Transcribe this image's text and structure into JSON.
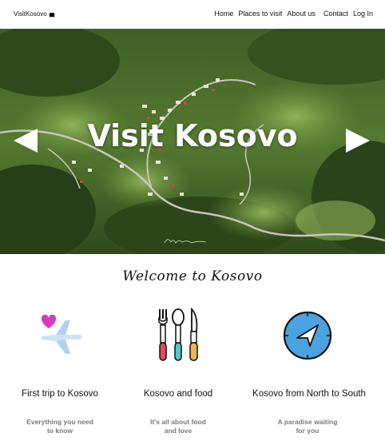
{
  "header": {
    "logo_text": "VisitKosovo",
    "nav": [
      "Home",
      "Places to visit",
      "About us",
      "Contact",
      "Log In"
    ]
  },
  "hero": {
    "title": "Visit Kosovo",
    "prev_icon": "left-arrow-icon",
    "next_icon": "right-arrow-icon"
  },
  "welcome": "Welcome to Kosovo",
  "cards": [
    {
      "icon": "airplane-heart-icon",
      "title": "First trip to Kosovo",
      "line1": "Everything you need",
      "line2": "to know"
    },
    {
      "icon": "cutlery-icon",
      "title": "Kosovo and food",
      "line1": "It's all about food",
      "line2": "and love"
    },
    {
      "icon": "compass-icon",
      "title": "Kosovo from North to South",
      "line1": "A paradise waiting",
      "line2": "for you"
    }
  ],
  "colors": {
    "hero_green_dark": "#2f4a1e",
    "hero_green_light": "#7fa04a",
    "compass_blue": "#4aa3df",
    "heart_pink": "#d63bbf"
  }
}
